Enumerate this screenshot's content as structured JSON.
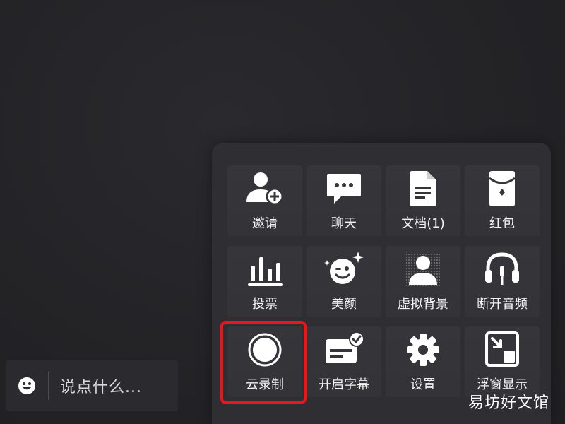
{
  "chat": {
    "placeholder": "说点什么...",
    "emoji_icon": "smiley-icon"
  },
  "panel": {
    "items": [
      {
        "label": "邀请",
        "icon": "invite-user-icon",
        "selected": false
      },
      {
        "label": "聊天",
        "icon": "chat-bubble-icon",
        "selected": false
      },
      {
        "label": "文档(1)",
        "icon": "document-icon",
        "selected": false
      },
      {
        "label": "红包",
        "icon": "red-packet-icon",
        "selected": false
      },
      {
        "label": "投票",
        "icon": "vote-bars-icon",
        "selected": false
      },
      {
        "label": "美颜",
        "icon": "beauty-face-icon",
        "selected": false
      },
      {
        "label": "虚拟背景",
        "icon": "virtual-background-icon",
        "selected": false
      },
      {
        "label": "断开音频",
        "icon": "headphones-icon",
        "selected": false
      },
      {
        "label": "云录制",
        "icon": "record-icon",
        "selected": true
      },
      {
        "label": "开启字幕",
        "icon": "subtitles-icon",
        "selected": false
      },
      {
        "label": "设置",
        "icon": "gear-icon",
        "selected": false
      },
      {
        "label": "浮窗显示",
        "icon": "floating-window-icon",
        "selected": false
      }
    ]
  },
  "watermark": "易坊好文馆",
  "colors": {
    "background": "#232326",
    "panel": "#2f2f33",
    "tile": "#35353a",
    "highlight": "#e8171c"
  }
}
